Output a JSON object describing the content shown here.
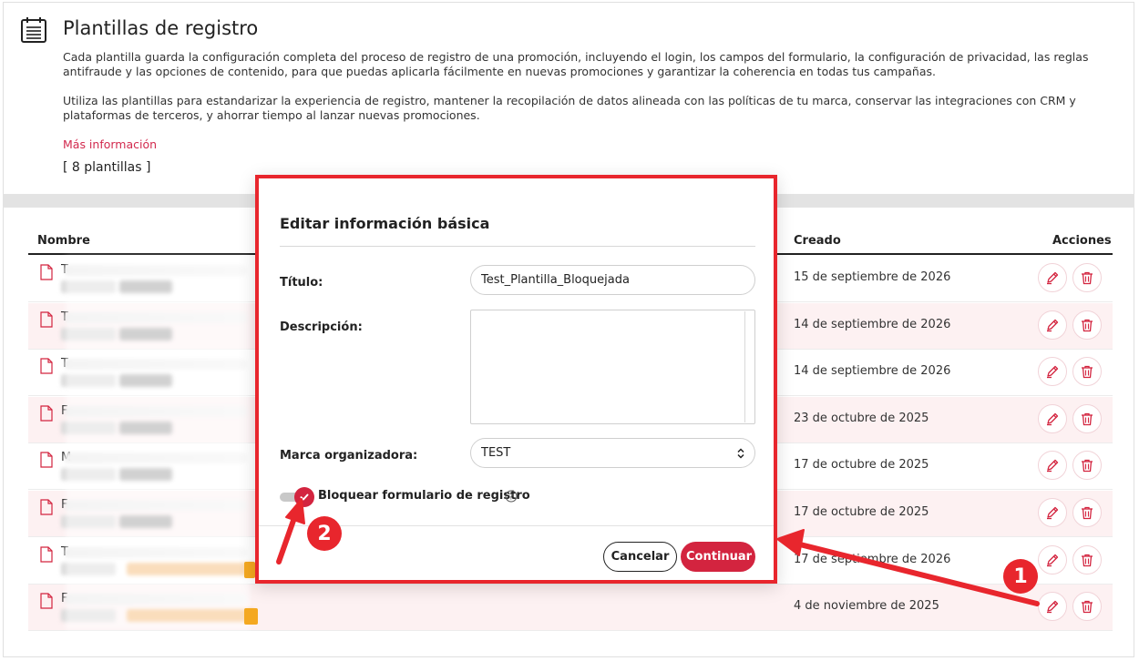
{
  "header": {
    "title": "Plantillas de registro",
    "description_1": "Cada plantilla guarda la configuración completa del proceso de registro de una promoción, incluyendo el login, los campos del formulario, la configuración de privacidad, las reglas antifraude y las opciones de contenido, para que puedas aplicarla fácilmente en nuevas promociones y garantizar la coherencia en todas tus campañas.",
    "description_2": "Utiliza las plantillas para estandarizar la experiencia de registro, mantener la recopilación de datos alineada con las políticas de tu marca, conservar las integraciones con CRM y plataformas de terceros, y ahorrar tiempo al lanzar nuevas promociones.",
    "more_link": "Más información",
    "count": "[ 8 plantillas ]"
  },
  "table": {
    "columns": {
      "name": "Nombre",
      "created": "Creado",
      "actions": "Acciones"
    },
    "rows": [
      {
        "initial": "T",
        "created": "15 de septiembre de 2026"
      },
      {
        "initial": "T",
        "created": "14 de septiembre de 2026"
      },
      {
        "initial": "T",
        "created": "14 de septiembre de 2026"
      },
      {
        "initial": "F",
        "created": "23 de octubre de 2025"
      },
      {
        "initial": "M",
        "created": "17 de octubre de 2025"
      },
      {
        "initial": "F",
        "created": "17 de octubre de 2025"
      },
      {
        "initial": "T",
        "created": "17 de septiembre de 2026"
      },
      {
        "initial": "F",
        "created": "4 de noviembre de 2025"
      }
    ]
  },
  "modal": {
    "title": "Editar información básica",
    "title_label": "Título:",
    "title_value": "Test_Plantilla_Bloquejada",
    "description_label": "Descripción:",
    "description_value": "",
    "brand_label": "Marca organizadora:",
    "brand_value": "TEST",
    "lock_label": "Bloquear formulario de registro",
    "lock_checked": true,
    "cancel_label": "Cancelar",
    "continue_label": "Continuar"
  },
  "annotations": {
    "step1": "1",
    "step2": "2"
  },
  "colors": {
    "accent": "#d3243f",
    "annotation_red": "#e8262d",
    "row_alt": "#fdf1f2"
  }
}
